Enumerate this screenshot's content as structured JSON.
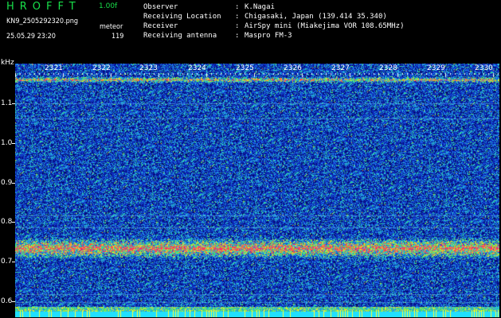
{
  "header": {
    "logo": "HROFFT",
    "version": "1.00f",
    "filename": "KN9_2505292320.png",
    "meteor_label": "meteor",
    "datetime": "25.05.29 23:20",
    "meteor_count": "119"
  },
  "meta": [
    {
      "key": "Observer",
      "value": "K.Nagai"
    },
    {
      "key": "Receiving Location",
      "value": "Chigasaki, Japan (139.414 35.340)"
    },
    {
      "key": "Receiver",
      "value": "AirSpy mini (Miakejima VOR 108.65MHz)"
    },
    {
      "key": "Receiving antenna",
      "value": "Maspro FM-3"
    }
  ],
  "axis": {
    "y_unit": "kHz",
    "y_ticks": [
      "1.1",
      "1.0",
      "0.9",
      "0.8",
      "0.7",
      "0.6"
    ],
    "x_ticks": [
      "2321",
      "2322",
      "2323",
      "2324",
      "2325",
      "2326",
      "2327",
      "2328",
      "2329",
      "2330"
    ]
  },
  "colors": {
    "logo": "#18e04a",
    "background": "#000000",
    "noise_base": "#0a1a8c",
    "signal_core": "#ff2a6a"
  }
}
